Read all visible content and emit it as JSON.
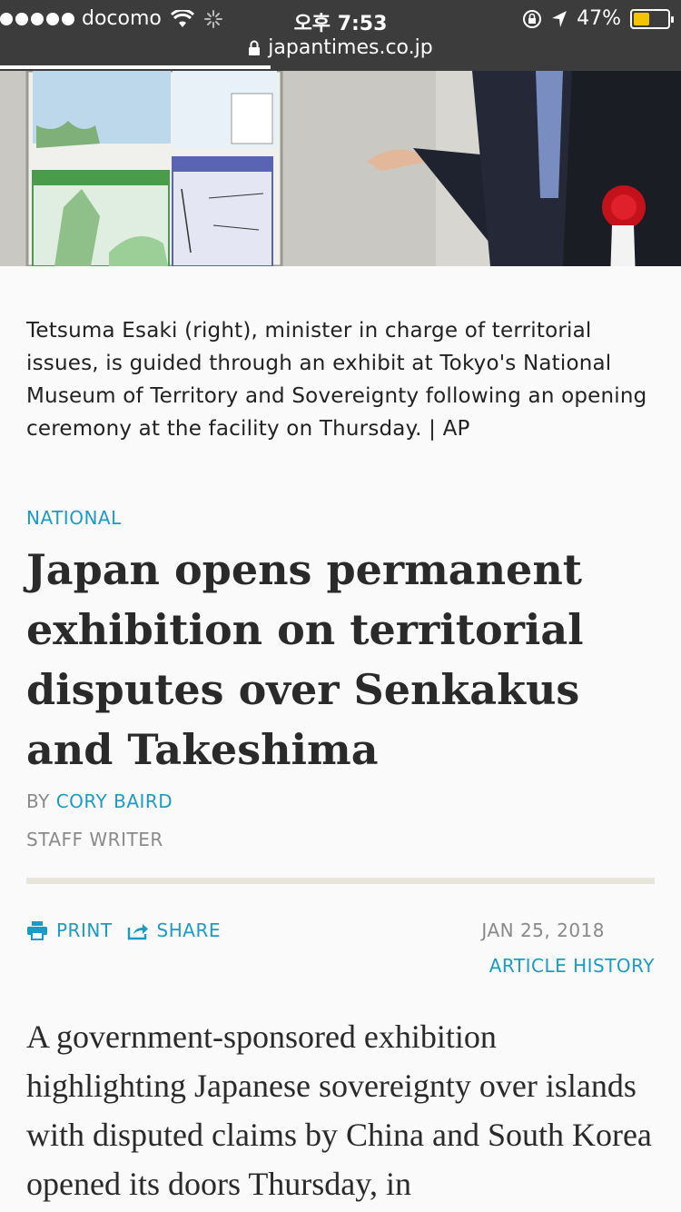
{
  "status_bar": {
    "carrier": "docomo",
    "time": "오후 7:53",
    "battery": "47%",
    "battery_level": 0.47
  },
  "browser": {
    "url": "japantimes.co.jp"
  },
  "article": {
    "caption": "Tetsuma Esaki (right), minister in charge of territorial issues, is guided through an exhibit at Tokyo's National Museum of Territory and Sovereignty following an opening ceremony at the facility on Thursday. | AP",
    "section": "NATIONAL",
    "headline": "Japan opens permanent exhibition on territorial disputes over Senkakus and Takeshima",
    "by_prefix": "BY",
    "author": "CORY BAIRD",
    "role": "STAFF WRITER",
    "print_label": "PRINT",
    "share_label": "SHARE",
    "date": "JAN 25, 2018",
    "history_label": "ARTICLE HISTORY",
    "body": "A government-sponsored exhibition highlighting Japanese sovereignty over islands with disputed claims by China and South Korea opened its doors Thursday, in"
  },
  "colors": {
    "chrome": "#3c3c3c",
    "accent": "#1a9cc7",
    "battery": "#f5c400"
  }
}
